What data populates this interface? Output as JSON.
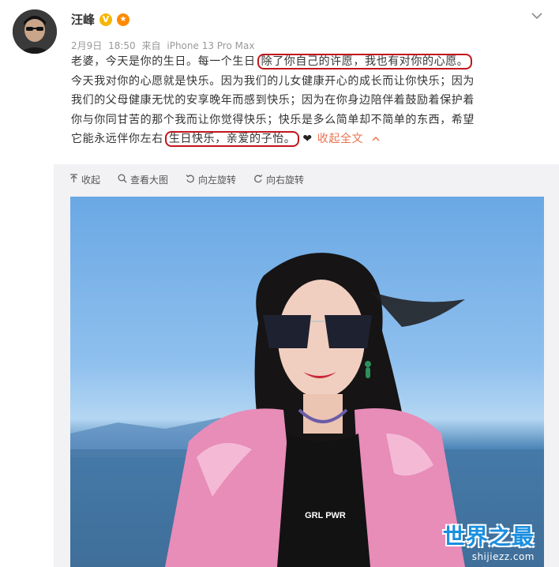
{
  "user": {
    "name": "汪峰",
    "verified_icon": "verified-v-icon",
    "medal_icon": "medal-icon"
  },
  "meta": {
    "date": "2月9日",
    "time": "18:50",
    "source_prefix": "来自",
    "device": "iPhone 13 Pro Max"
  },
  "post": {
    "line1_a": "老婆，今天是你的生日。每一个生日",
    "line1_highlight": "除了你自己的许愿，我也有对你的心愿。",
    "line2": "今天我对你的心愿就是快乐。因为我们的儿女健康开心的成长而让你快乐；因为",
    "line3": "我们的父母健康无忧的安享晚年而感到快乐；因为在你身边陪伴着鼓励着保护着",
    "line4": "你与你同甘苦的那个我而让你觉得快乐；快乐是多么简单却不简单的东西，希望",
    "line5_a": "它能永远伴你左右",
    "line5_highlight": "生日快乐，亲爱的子怡。",
    "heart": "❤",
    "collapse_label": "收起全文",
    "collapse_icon": "chevron-up-icon"
  },
  "toolbar": {
    "collapse": "收起",
    "view_large": "查看大图",
    "rotate_left": "向左旋转",
    "rotate_right": "向右旋转"
  },
  "photo": {
    "shirt_text": "GRL PWR"
  },
  "watermark": {
    "main": "世界之最",
    "sub": "shijiezz.com"
  },
  "colors": {
    "highlight_border": "#c0161c",
    "link": "#eb7350",
    "meta": "#999999",
    "watermark": "#1a8fe0"
  }
}
